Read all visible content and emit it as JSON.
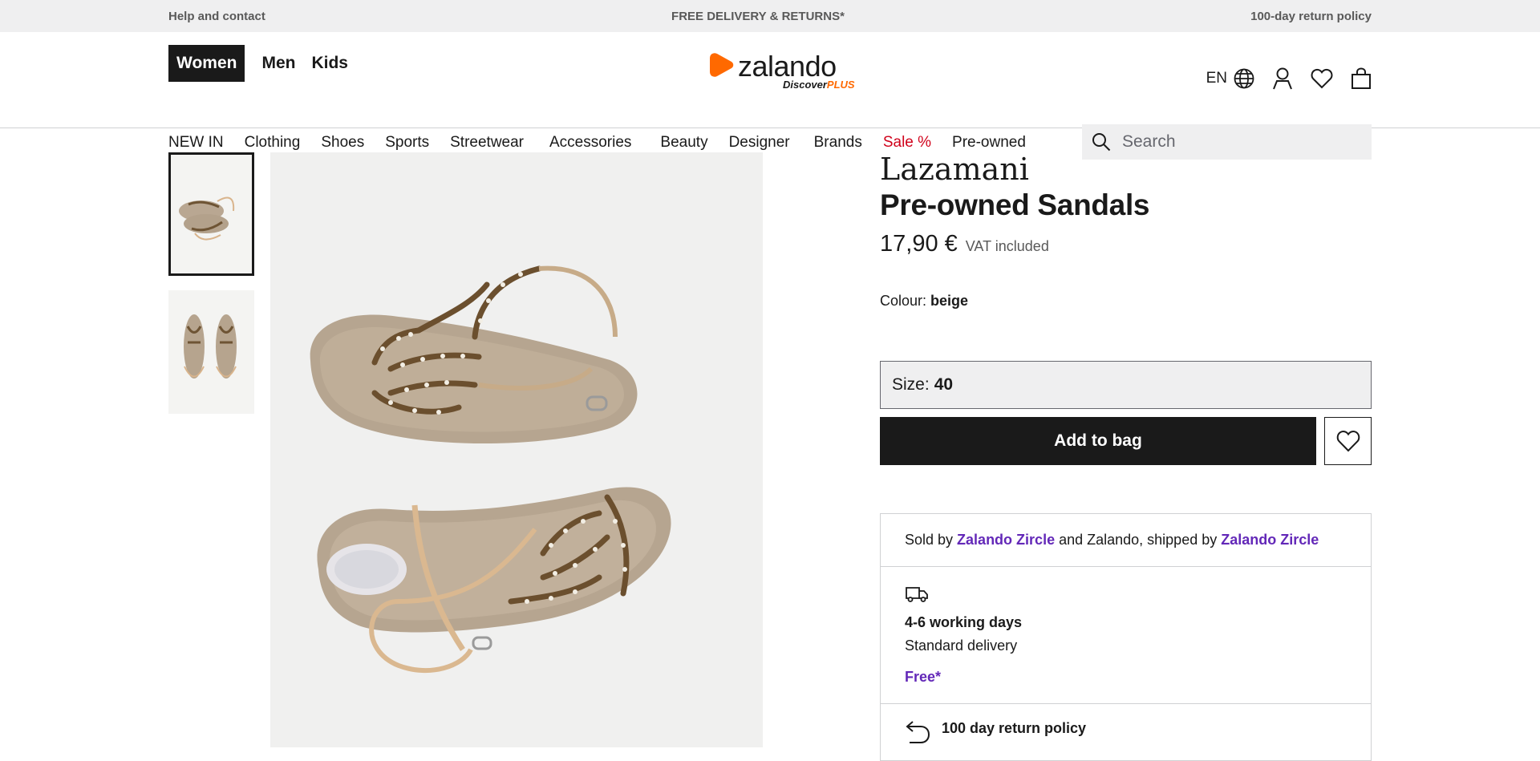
{
  "topbar": {
    "left": "Help and contact",
    "center": "FREE DELIVERY & RETURNS*",
    "right": "100-day return policy"
  },
  "header": {
    "genders": [
      "Women",
      "Men",
      "Kids"
    ],
    "logo_text": "zalando",
    "logo_tag_discover": "Discover",
    "logo_tag_plus": "PLUS",
    "language": "EN"
  },
  "nav": {
    "items": [
      "NEW IN",
      "Clothing",
      "Shoes",
      "Sports",
      "Streetwear",
      "Accessories",
      "Beauty",
      "Designer",
      "Brands",
      "Sale %",
      "Pre-owned"
    ]
  },
  "search": {
    "placeholder": "Search"
  },
  "product": {
    "brand": "Lazamani",
    "name": "Pre-owned Sandals",
    "price": "17,90 €",
    "vat": "VAT included",
    "colour_label": "Colour:",
    "colour_value": "beige",
    "size_label": "Size:",
    "size_value": "40",
    "add_to_bag": "Add to bag"
  },
  "seller": {
    "sold_by": "Sold by",
    "seller1": "Zalando Zircle",
    "and_text": "and Zalando, shipped by",
    "seller2": "Zalando Zircle"
  },
  "delivery": {
    "days": "4-6 working days",
    "type": "Standard delivery",
    "price": "Free*"
  },
  "returns": {
    "label": "100 day return policy"
  },
  "colors": {
    "accent_purple": "#6328b8",
    "sale_red": "#d0021b",
    "brand_orange": "#ff6900"
  }
}
